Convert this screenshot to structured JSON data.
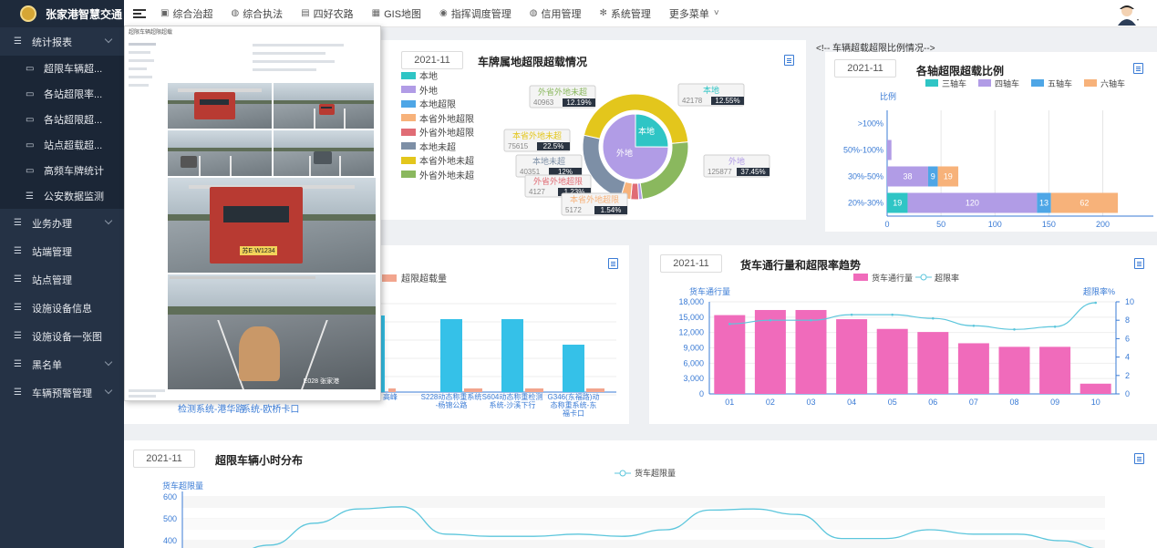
{
  "app": {
    "title": "张家港智慧交通"
  },
  "topnav": [
    {
      "label": "综合治超",
      "icon": "monitor-icon"
    },
    {
      "label": "综合执法",
      "icon": "globe-icon"
    },
    {
      "label": "四好农路",
      "icon": "road-icon"
    },
    {
      "label": "GIS地图",
      "icon": "map-icon"
    },
    {
      "label": "指挥调度管理",
      "icon": "eye-icon"
    },
    {
      "label": "信用管理",
      "icon": "globe-icon"
    },
    {
      "label": "系统管理",
      "icon": "gear-icon"
    },
    {
      "label": "更多菜单",
      "icon": "chevron-down-icon"
    }
  ],
  "sidebar": {
    "items": [
      {
        "label": "统计报表",
        "icon": "list-icon",
        "expanded": true,
        "children": [
          {
            "label": "超限车辆超...",
            "icon": "chart-icon"
          },
          {
            "label": "各站超限率...",
            "icon": "chart-icon"
          },
          {
            "label": "各站超限超...",
            "icon": "chart-icon"
          },
          {
            "label": "站点超载超...",
            "icon": "chart-icon"
          },
          {
            "label": "高频车牌统计",
            "icon": "chart-icon"
          },
          {
            "label": "公安数据监测",
            "icon": "list-icon"
          }
        ]
      },
      {
        "label": "业务办理",
        "icon": "list-icon"
      },
      {
        "label": "站端管理",
        "icon": "list-icon"
      },
      {
        "label": "站点管理",
        "icon": "list-icon"
      },
      {
        "label": "设施设备信息",
        "icon": "list-icon"
      },
      {
        "label": "设施设备一张图",
        "icon": "list-icon"
      },
      {
        "label": "黑名单",
        "icon": "list-icon"
      },
      {
        "label": "车辆预警管理",
        "icon": "list-icon"
      }
    ]
  },
  "donut_panel": {
    "month": "2021-11",
    "title": "车牌属地超限超载情况",
    "legend": [
      "本地",
      "外地",
      "本地超限",
      "本省外地超限",
      "外省外地超限",
      "本地未超",
      "本省外地未超",
      "外省外地未超"
    ],
    "legend_colors": [
      "#2fc5c5",
      "#b19ce6",
      "#4ea6e6",
      "#f7b27a",
      "#e06c75",
      "#7d8fa6",
      "#e3c61c",
      "#8ab85e"
    ],
    "inner_labels": [
      "本地",
      "外地"
    ],
    "callouts": [
      {
        "name": "外省外地未超",
        "value": "40963",
        "pct": "12.19%"
      },
      {
        "name": "本地",
        "value": "42178",
        "pct": "12.55%"
      },
      {
        "name": "本省外地未超",
        "value": "75615",
        "pct": "22.5%"
      },
      {
        "name": "外地",
        "value": "125877",
        "pct": "37.45%"
      },
      {
        "name": "本地未超",
        "value": "40351",
        "pct": "12%"
      },
      {
        "name": "外省外地超限",
        "value": "4127",
        "pct": "1.23%"
      },
      {
        "name": "本省外地超限",
        "value": "5172",
        "pct": "1.54%"
      }
    ]
  },
  "ratio_panel": {
    "caption": "<!-- 车辆超载超限比例情况-->",
    "month": "2021-11",
    "title": "各轴超限超载比例"
  },
  "station_panel": {
    "legend": "超限超载量",
    "stations": [
      "高峰",
      "S228动态称重系统-杨锦公路",
      "S604动态称重检测系统-沙溪下行",
      "G346(东福路)动态称重系统-东福卡口"
    ],
    "left_labels": [
      "检测系统-港华路",
      "系统-欧桥卡口"
    ]
  },
  "trend_panel": {
    "month": "2021-11",
    "title": "货车通行量和超限率趋势"
  },
  "hourly_panel": {
    "month": "2021-11",
    "title": "超限车辆小时分布"
  },
  "overlay": {
    "title": "超限车辆超限超载",
    "plate_text": "苏E·W1234",
    "cam_caption": "E028 张家港"
  },
  "chart_data": [
    {
      "type": "pie",
      "title": "车牌属地超限超载情况",
      "inner": {
        "labels": [
          "本地",
          "外地"
        ],
        "values": [
          42178,
          125877
        ]
      },
      "outer": {
        "labels": [
          "本地未超",
          "本地超限",
          "外省外地超限",
          "本省外地超限",
          "外省外地未超",
          "本省外地未超"
        ],
        "values": [
          40351,
          1827,
          4127,
          5172,
          40963,
          75615
        ]
      }
    },
    {
      "type": "bar",
      "orientation": "horizontal",
      "stacked": true,
      "title": "各轴超限超载比例",
      "ylabel": "比例",
      "categories": [
        "20%-30%",
        "30%-50%",
        "50%-100%",
        ">100%"
      ],
      "series": [
        {
          "name": "三轴车",
          "color": "#2fc5c5",
          "values": [
            19,
            0,
            0,
            0
          ]
        },
        {
          "name": "四轴车",
          "color": "#b19ce6",
          "values": [
            120,
            38,
            4,
            0
          ]
        },
        {
          "name": "五轴车",
          "color": "#4ea6e6",
          "values": [
            13,
            9,
            0,
            0
          ]
        },
        {
          "name": "六轴车",
          "color": "#f7b27a",
          "values": [
            62,
            19,
            0,
            0
          ]
        }
      ],
      "xticks": [
        0,
        50,
        100,
        150,
        200
      ],
      "xlim": [
        0,
        230
      ]
    },
    {
      "type": "bar",
      "title": "",
      "categories": [
        "高峰",
        "S228动态称重系统-杨锦公路",
        "S604动态称重检测系统-沙溪下行",
        "G346(东福路)动态称重系统-东福卡口"
      ],
      "series": [
        {
          "name": "超限超载量",
          "color": "#f2a58e",
          "values": [
            1,
            1,
            1,
            1
          ]
        },
        {
          "name": "",
          "color": "#35c1e8",
          "values": [
            42,
            40,
            40,
            26
          ]
        }
      ]
    },
    {
      "type": "bar",
      "title": "货车通行量和超限率趋势",
      "categories": [
        "01",
        "02",
        "03",
        "04",
        "05",
        "06",
        "07",
        "08",
        "09",
        "10"
      ],
      "series": [
        {
          "name": "货车通行量",
          "color": "#f06bbb",
          "values": [
            15400,
            16400,
            16400,
            14600,
            12700,
            12100,
            9900,
            9200,
            9200,
            2000
          ]
        },
        {
          "name": "超限率",
          "color": "#5cc6dc",
          "type": "line",
          "axis": "right",
          "values": [
            7.6,
            8.0,
            8.0,
            8.6,
            8.6,
            8.2,
            7.4,
            7.0,
            7.3,
            9.9
          ]
        }
      ],
      "ylabel_left": "货车通行量",
      "ylabel_right": "超限率%",
      "ylim_left": [
        0,
        18000
      ],
      "yticks_left": [
        0,
        3000,
        6000,
        9000,
        12000,
        15000,
        18000
      ],
      "ylim_right": [
        0,
        10
      ],
      "yticks_right": [
        0,
        2,
        4,
        6,
        8,
        10
      ]
    },
    {
      "type": "line",
      "title": "超限车辆小时分布",
      "series": [
        {
          "name": "货车超限量",
          "color": "#5cc6dc",
          "values": [
            360,
            330,
            380,
            480,
            545,
            555,
            430,
            420,
            420,
            430,
            420,
            450,
            540,
            545,
            520,
            410,
            410,
            450,
            430,
            430,
            400,
            360
          ]
        }
      ],
      "ylabel": "货车超限量",
      "yticks": [
        400,
        500,
        600
      ]
    }
  ]
}
